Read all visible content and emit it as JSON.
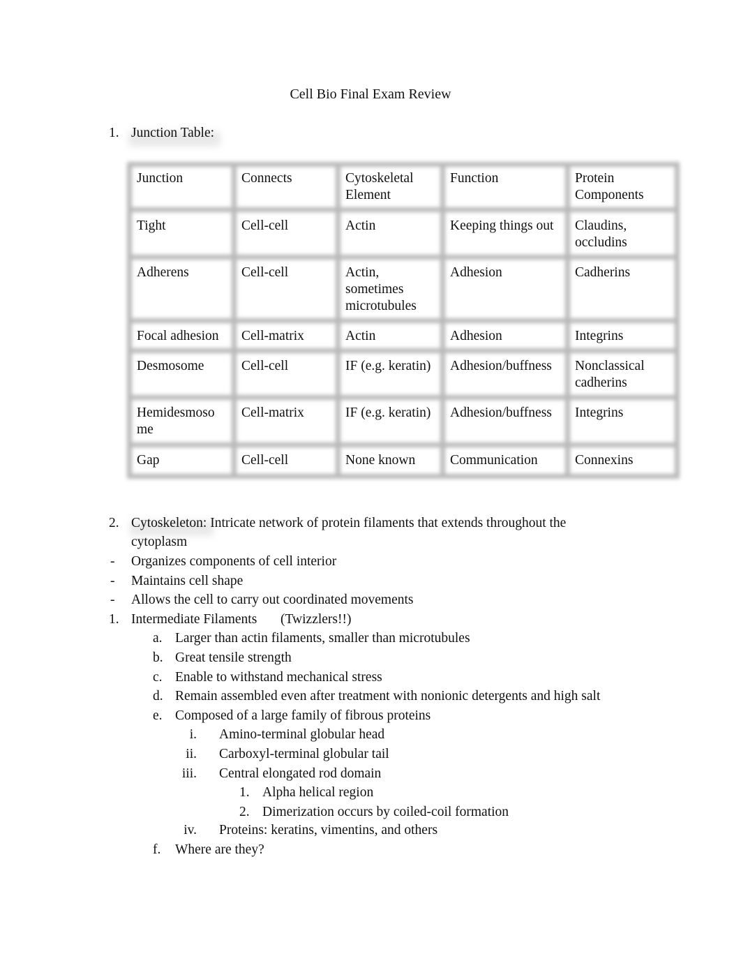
{
  "document": {
    "title": "Cell Bio Final Exam Review"
  },
  "section1": {
    "number": "1.",
    "label": "Junction Table:"
  },
  "junction_table": {
    "headers": [
      "Junction",
      "Connects",
      "Cytoskeletal Element",
      "Function",
      "Protein Components"
    ],
    "rows": [
      [
        "Tight",
        "Cell-cell",
        "Actin",
        "Keeping things out",
        "Claudins, occludins"
      ],
      [
        "Adherens",
        "Cell-cell",
        "Actin, sometimes microtubules",
        "Adhesion",
        "Cadherins"
      ],
      [
        "Focal adhesion",
        "Cell-matrix",
        "Actin",
        "Adhesion",
        "Integrins"
      ],
      [
        "Desmosome",
        "Cell-cell",
        "IF (e.g. keratin)",
        "Adhesion/buffness",
        "Nonclassical cadherins"
      ],
      [
        "Hemidesmosome",
        "Cell-matrix",
        "IF (e.g. keratin)",
        "Adhesion/buffness",
        "Integrins"
      ],
      [
        "Gap",
        "Cell-cell",
        "None known",
        "Communication",
        "Connexins"
      ]
    ]
  },
  "section2": {
    "number": "2.",
    "heading_line1": "Cytoskeleton: Intricate network of protein filaments that extends throughout the",
    "heading_line2": "cytoplasm",
    "bullets": [
      {
        "marker": "-",
        "text": "Organizes components of cell interior"
      },
      {
        "marker": "-",
        "text": "Maintains cell shape"
      },
      {
        "marker": "-",
        "text": "Allows the cell to carry out coordinated movements"
      }
    ],
    "subsection": {
      "number": "1.",
      "title": "Intermediate Filaments",
      "note": "(Twizzlers!!)",
      "items": [
        {
          "marker": "a.",
          "text": "Larger than actin filaments, smaller than microtubules"
        },
        {
          "marker": "b.",
          "text": "Great tensile strength"
        },
        {
          "marker": "c.",
          "text": "Enable to withstand mechanical stress"
        },
        {
          "marker": "d.",
          "text": "Remain assembled even after treatment with nonionic detergents and high salt"
        },
        {
          "marker": "e.",
          "text": "Composed of a large family of fibrous proteins"
        }
      ],
      "e_subitems": [
        {
          "marker": "i.",
          "text": "Amino-terminal globular head"
        },
        {
          "marker": "ii.",
          "text": "Carboxyl-terminal globular tail"
        },
        {
          "marker": "iii.",
          "text": "Central elongated rod domain"
        }
      ],
      "rod_subitems": [
        {
          "marker": "1.",
          "text": "Alpha helical region"
        },
        {
          "marker": "2.",
          "text": "Dimerization occurs by coiled-coil formation"
        }
      ],
      "e_subitem_iv": {
        "marker": "iv.",
        "text": "Proteins: keratins, vimentins, and others"
      },
      "item_f": {
        "marker": "f.",
        "text": "Where are they?"
      }
    }
  }
}
